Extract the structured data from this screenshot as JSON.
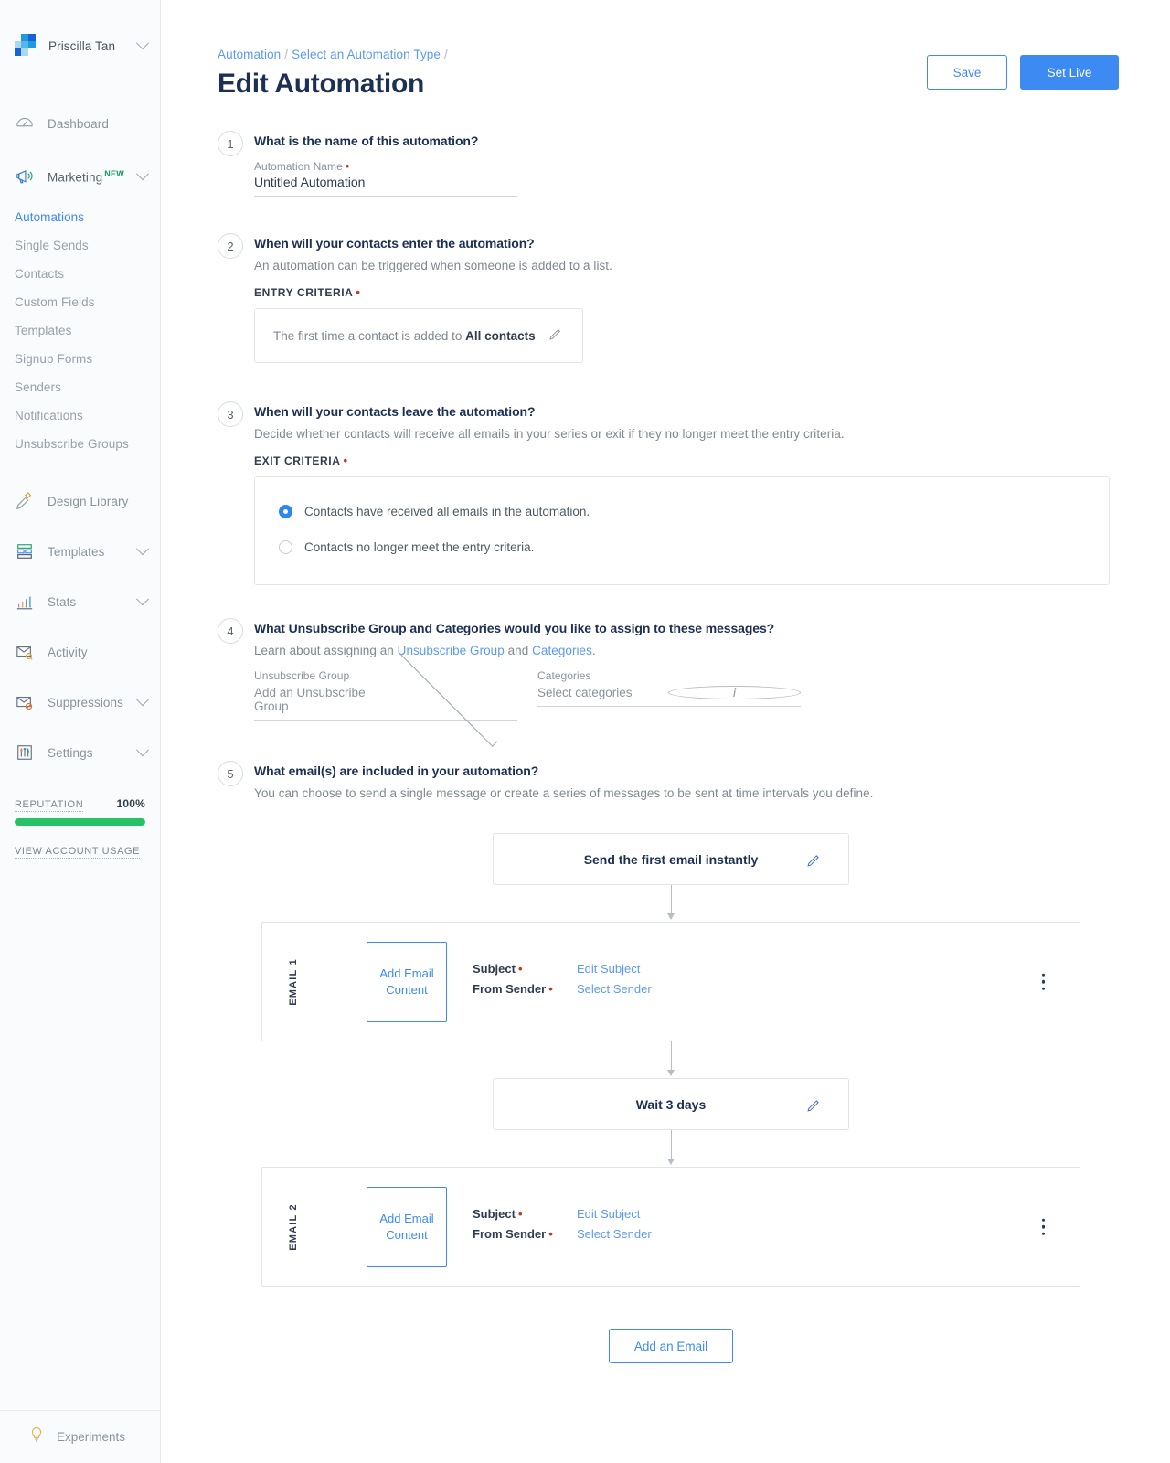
{
  "sidebar": {
    "account": {
      "name": "Priscilla Tan",
      "logo_icon": "sendgrid-logo-icon",
      "chevron_icon": "chevron-down-icon"
    },
    "dashboard": {
      "label": "Dashboard",
      "icon": "speedometer-icon"
    },
    "marketing": {
      "label": "Marketing",
      "badge": "NEW",
      "icon": "megaphone-icon",
      "chevron_icon": "chevron-down-icon"
    },
    "marketing_items": [
      {
        "label": "Automations",
        "active": true
      },
      {
        "label": "Single Sends",
        "active": false
      },
      {
        "label": "Contacts",
        "active": false
      },
      {
        "label": "Custom Fields",
        "active": false
      },
      {
        "label": "Templates",
        "active": false
      },
      {
        "label": "Signup Forms",
        "active": false
      },
      {
        "label": "Senders",
        "active": false
      },
      {
        "label": "Notifications",
        "active": false
      },
      {
        "label": "Unsubscribe Groups",
        "active": false
      }
    ],
    "sections": [
      {
        "label": "Design Library",
        "icon": "pencil-ruler-icon",
        "chevron": false
      },
      {
        "label": "Templates",
        "icon": "layout-template-icon",
        "chevron": true
      },
      {
        "label": "Stats",
        "icon": "bar-chart-icon",
        "chevron": true
      },
      {
        "label": "Activity",
        "icon": "envelope-search-icon",
        "chevron": false
      },
      {
        "label": "Suppressions",
        "icon": "envelope-block-icon",
        "chevron": true
      },
      {
        "label": "Settings",
        "icon": "sliders-icon",
        "chevron": true
      }
    ],
    "reputation": {
      "label": "REPUTATION",
      "percent": "100%",
      "fill": 100,
      "color": "#27c166"
    },
    "account_usage": "VIEW ACCOUNT USAGE",
    "experiments": {
      "label": "Experiments",
      "icon": "lightbulb-icon"
    }
  },
  "header": {
    "breadcrumb": {
      "first": "Automation",
      "second": "Select an Automation Type",
      "sep": "/"
    },
    "title": "Edit Automation",
    "save_label": "Save",
    "set_live_label": "Set Live"
  },
  "steps": {
    "one": {
      "number": "1",
      "question": "What is the name of this automation?",
      "field_label": "Automation Name",
      "value": "Untitled Automation"
    },
    "two": {
      "number": "2",
      "question": "When will your contacts enter the automation?",
      "description": "An automation can be triggered when someone is added to a list.",
      "criteria_label": "ENTRY CRITERIA",
      "criteria_text": "The first time a contact is added to",
      "criteria_target": "All contacts",
      "edit_icon": "pencil-icon"
    },
    "three": {
      "number": "3",
      "question": "When will your contacts leave the automation?",
      "description": "Decide whether contacts will receive all emails in your series or exit if they no longer meet the entry criteria.",
      "criteria_label": "EXIT CRITERIA",
      "option_one": "Contacts have received all emails in the automation.",
      "option_two": "Contacts no longer meet the entry criteria.",
      "selected": "option_one"
    },
    "four": {
      "number": "4",
      "question": "What Unsubscribe Group and Categories would you like to assign to these messages?",
      "learn_prefix": "Learn about assigning an",
      "link_one": "Unsubscribe Group",
      "learn_mid": "and",
      "link_two": "Categories",
      "learn_suffix": ".",
      "unsub_label": "Unsubscribe Group",
      "unsub_value": "Add an Unsubscribe Group",
      "categories_label": "Categories",
      "categories_value": "Select categories",
      "info_icon": "info-icon"
    },
    "five": {
      "number": "5",
      "question": "What email(s) are included in your automation?",
      "description": "You can choose to send a single message or create a series of messages to be sent at time intervals you define.",
      "first_delay": "Send the first email instantly",
      "wait_step": "Wait 3 days",
      "add_email_label": "Add an Email",
      "emails": [
        {
          "rail": "EMAIL 1",
          "add_content": "Add Email\nContent",
          "add_content_line1": "Add Email",
          "add_content_line2": "Content",
          "subject_label": "Subject",
          "subject_link": "Edit Subject",
          "sender_label": "From Sender",
          "sender_link": "Select Sender"
        },
        {
          "rail": "EMAIL 2",
          "add_content_line1": "Add Email",
          "add_content_line2": "Content",
          "subject_label": "Subject",
          "subject_link": "Edit Subject",
          "sender_label": "From Sender",
          "sender_link": "Select Sender"
        }
      ]
    }
  },
  "colors": {
    "accent": "#3d8bf2",
    "link": "#5b9bf0",
    "required": "#c0392b",
    "title": "#1c3053",
    "reputation": "#27c166"
  }
}
